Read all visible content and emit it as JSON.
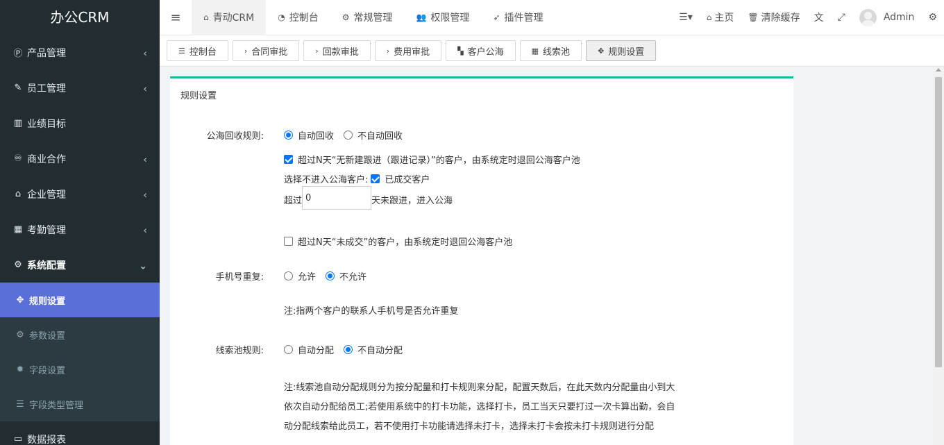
{
  "app": {
    "logo": "办公CRM"
  },
  "sidebar": {
    "items": [
      {
        "label": "产品管理",
        "icon": "product-hunt-icon",
        "glyph": "Ⓟ",
        "chevron": "‹"
      },
      {
        "label": "员工管理",
        "icon": "brush-icon",
        "glyph": "✎",
        "chevron": "‹"
      },
      {
        "label": "业绩目标",
        "icon": "bar-chart-icon",
        "glyph": "▥",
        "chevron": ""
      },
      {
        "label": "商业合作",
        "icon": "handshake-icon",
        "glyph": "♾",
        "chevron": "‹"
      },
      {
        "label": "企业管理",
        "icon": "bank-icon",
        "glyph": "⌂",
        "chevron": "‹"
      },
      {
        "label": "考勤管理",
        "icon": "calendar-icon",
        "glyph": "▦",
        "chevron": "‹"
      },
      {
        "label": "系统配置",
        "icon": "gear-icon",
        "glyph": "⚙",
        "chevron": "⌄"
      }
    ],
    "sub_items": [
      {
        "label": "规则设置",
        "icon": "arrows-icon",
        "glyph": "✥"
      },
      {
        "label": "参数设置",
        "icon": "cogs-icon",
        "glyph": "⚙"
      },
      {
        "label": "字段设置",
        "icon": "gear-icon",
        "glyph": "✹"
      },
      {
        "label": "字段类型管理",
        "icon": "list-icon",
        "glyph": "☰"
      }
    ],
    "bottom_item": {
      "label": "数据报表",
      "icon": "monitor-icon",
      "glyph": "▭"
    }
  },
  "header": {
    "menu_glyph": "≡",
    "nav": [
      {
        "label": "青动CRM",
        "icon": "home-icon",
        "glyph": "⌂"
      },
      {
        "label": "控制台",
        "icon": "dashboard-icon",
        "glyph": "◔"
      },
      {
        "label": "常规管理",
        "icon": "cogs-icon",
        "glyph": "⚙"
      },
      {
        "label": "权限管理",
        "icon": "users-icon",
        "glyph": "👥"
      },
      {
        "label": "插件管理",
        "icon": "rocket-icon",
        "glyph": "➶"
      }
    ],
    "right": {
      "list_glyph": "☰▾",
      "home_label": "主页",
      "home_glyph": "⌂",
      "clear_cache_label": "清除缓存",
      "clear_cache_glyph": "🗑",
      "translate_glyph": "文",
      "fullscreen_glyph": "⤢",
      "user_name": "Admin",
      "settings_glyph": "⚙"
    }
  },
  "tabs": [
    {
      "label": "控制台",
      "icon": "list-icon",
      "glyph": "☰"
    },
    {
      "label": "合同审批",
      "icon": "chevron-right-icon",
      "glyph": "›"
    },
    {
      "label": "回款审批",
      "icon": "chevron-right-icon",
      "glyph": "›"
    },
    {
      "label": "费用审批",
      "icon": "chevron-right-icon",
      "glyph": "›"
    },
    {
      "label": "客户公海",
      "icon": "map-icon",
      "glyph": "▚"
    },
    {
      "label": "线索池",
      "icon": "grid-icon",
      "glyph": "▦"
    },
    {
      "label": "规则设置",
      "icon": "arrows-icon",
      "glyph": "✥"
    }
  ],
  "panel": {
    "title": "规则设置",
    "sea_rule": {
      "label": "公海回收规则:",
      "options": [
        "自动回收",
        "不自动回收"
      ],
      "selected": 0
    },
    "no_followup": {
      "checked": true,
      "text": "超过N天“无新建跟进（跟进记录）”的客户，由系统定时退回公海客户池"
    },
    "exclude": {
      "label": "选择不进入公海客户:",
      "checked": true,
      "option": "已成交客户"
    },
    "days": {
      "prefix": "超过",
      "value": "0",
      "suffix": "天未跟进，进入公海"
    },
    "not_closed": {
      "checked": false,
      "text": "超过N天“未成交”的客户，由系统定时退回公海客户池"
    },
    "phone_dup": {
      "label": "手机号重复:",
      "options": [
        "允许",
        "不允许"
      ],
      "selected": 1,
      "note": "注:指两个客户的联系人手机号是否允许重复"
    },
    "leads_rule": {
      "label": "线索池规则:",
      "options": [
        "自动分配",
        "不自动分配"
      ],
      "selected": 1,
      "note": "注:线索池自动分配规则分为按分配量和打卡规则来分配，配置天数后，在此天数内分配量由小到大依次自动分配给员工;若使用系统中的打卡功能，选择打卡，员工当天只要打过一次卡算出勤，会自动分配线索给此员工，若不使用打卡功能请选择未打卡，选择未打卡会按未打卡规则进行分配"
    }
  }
}
